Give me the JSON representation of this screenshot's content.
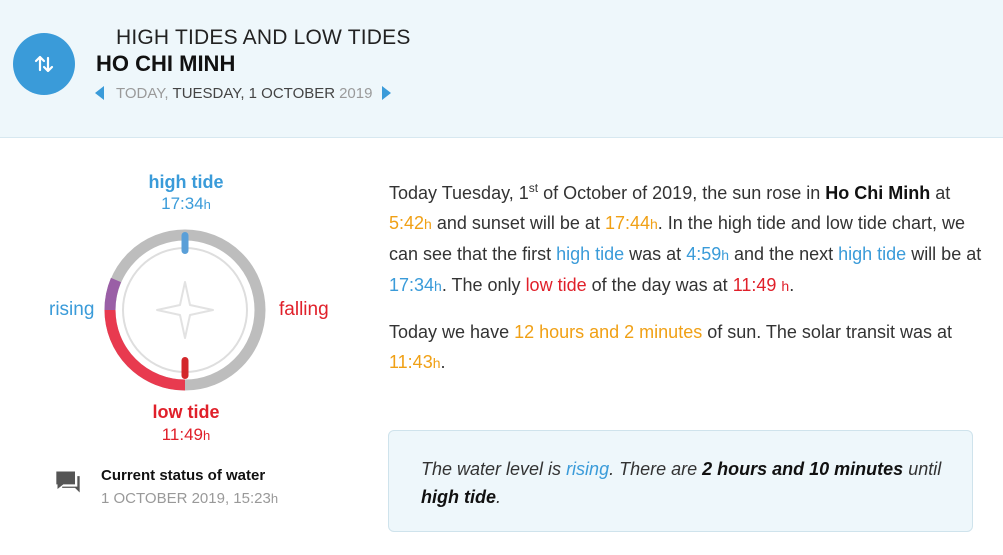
{
  "header": {
    "kicker": "HIGH TIDES AND LOW TIDES",
    "city": "HO CHI MINH",
    "date": {
      "today": "TODAY,",
      "day": "TUESDAY, 1 OCTOBER",
      "year": "2019"
    },
    "icon": "swap-vertical-icon"
  },
  "dial": {
    "high_title": "high tide",
    "high_time": "17:34",
    "high_unit": "h",
    "low_title": "low tide",
    "low_time": "11:49",
    "low_unit": "h",
    "rising": "rising",
    "falling": "falling",
    "colors": {
      "high": "#3a9bd9",
      "low": "#e0202a",
      "ring": "#b8b8b8",
      "rising_arc": "#9a5fa6"
    }
  },
  "status": {
    "title": "Current status of water",
    "date": "1 OCTOBER 2019, 15:23",
    "unit": "h",
    "icon": "chat-icon"
  },
  "para1": {
    "s1": "Today Tuesday, 1",
    "sup": "st",
    "s2": " of October of 2019, the sun rose in ",
    "city": "Ho Chi Minh",
    "s3": " at ",
    "sunrise": "5:42",
    "s4": " and sunset will be at ",
    "sunset": "17:44",
    "s5": ". In the high tide and low tide chart, we can see that the first ",
    "high1": "high tide",
    "s6": " was at ",
    "t1": "4:59",
    "s7": " and the next ",
    "high2": "high tide",
    "s8": " will be at ",
    "t2": "17:34",
    "s9": ". The only ",
    "low": "low tide",
    "s10": " of the day was at ",
    "t3": "11:49",
    "s11": "."
  },
  "para2": {
    "s1": "Today we have ",
    "duration": "12 hours and 2 minutes",
    "s2": " of sun. The solar transit was at ",
    "transit": "11:43",
    "s3": "."
  },
  "status_box": {
    "s1": "The water level is ",
    "state": "rising",
    "s2": ". There are ",
    "remaining": "2 hours and 10 minutes",
    "s3": " until ",
    "target": "high tide",
    "s4": "."
  },
  "units": {
    "h": "h"
  }
}
